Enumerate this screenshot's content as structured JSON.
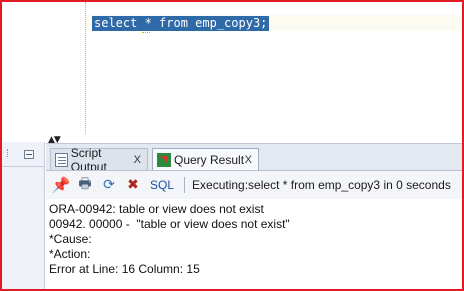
{
  "editor": {
    "code": "select * from emp_copy3;"
  },
  "output_panel": {
    "tabs": [
      {
        "label": "Script Output",
        "icon": "script-output-icon",
        "close": "X"
      },
      {
        "label": "Query Result",
        "icon": "query-result-icon",
        "close": "X",
        "active": true
      }
    ],
    "toolbar": {
      "icons": [
        "pin-icon",
        "print-icon",
        "refresh-icon",
        "export-icon"
      ],
      "sql_label": "SQL",
      "status": "Executing:select * from emp_copy3 in 0 seconds"
    },
    "messages": [
      "ORA-00942: table or view does not exist",
      "00942. 00000 -  \"table or view does not exist\"",
      "*Cause:",
      "*Action:",
      "Error at Line: 16 Column: 15"
    ]
  },
  "colors": {
    "frame_border": "#e01b24",
    "selection": "#2f6aa8",
    "panel_background": "#e9edf4"
  }
}
